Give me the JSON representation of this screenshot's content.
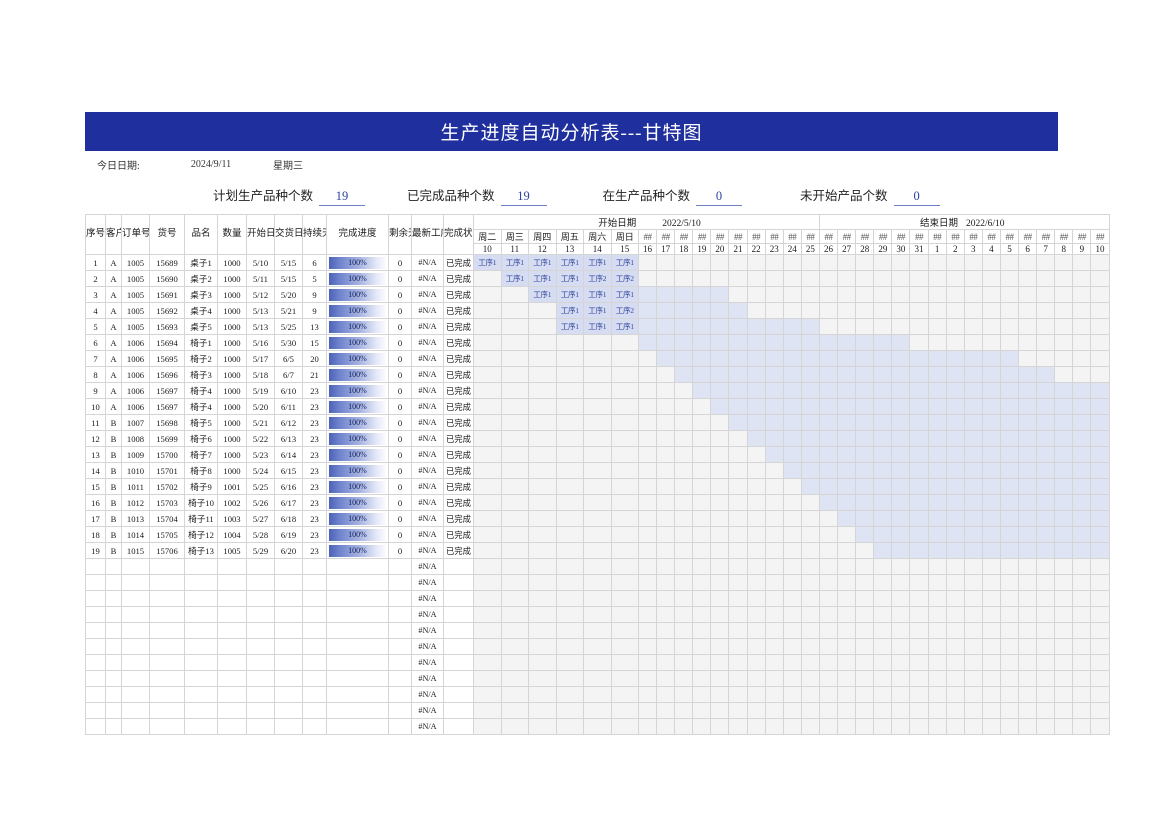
{
  "title": "生产进度自动分析表---甘特图",
  "today": {
    "label": "今日日期:",
    "date": "2024/9/11",
    "weekday": "星期三"
  },
  "summary": [
    {
      "label": "计划生产品种个数",
      "value": "19"
    },
    {
      "label": "已完成品种个数",
      "value": "19"
    },
    {
      "label": "在生产品种个数",
      "value": "0"
    },
    {
      "label": "未开始产品个数",
      "value": "0"
    }
  ],
  "columns": {
    "seq": "序号",
    "customer": "客户",
    "order": "订单号",
    "sku": "货号",
    "name": "品名",
    "qty": "数量",
    "start": "开始日期",
    "due": "交货日期",
    "duration": "持续天数",
    "progress": "完成进度",
    "remaining": "剩余天数",
    "latest_op": "最新工序状态",
    "status": "完成状态"
  },
  "gantt_header": {
    "start_label": "开始日期",
    "start_date": "2022/5/10",
    "end_label": "结束日期",
    "end_date": "2022/6/10",
    "weekdays": [
      "周二",
      "周三",
      "周四",
      "周五",
      "周六",
      "周日",
      "##",
      "##",
      "##",
      "##",
      "##",
      "##",
      "##",
      "##",
      "##",
      "##",
      "##",
      "##",
      "##",
      "##",
      "##",
      "##",
      "##",
      "##",
      "##",
      "##",
      "##",
      "##",
      "##",
      "##",
      "##",
      "##"
    ],
    "days": [
      10,
      11,
      12,
      13,
      14,
      15,
      16,
      17,
      18,
      19,
      20,
      21,
      22,
      23,
      24,
      25,
      26,
      27,
      28,
      29,
      30,
      31,
      1,
      2,
      3,
      4,
      5,
      6,
      7,
      8,
      9,
      10
    ]
  },
  "rows": [
    {
      "seq": "1",
      "customer": "A",
      "order": "1005",
      "sku": "15689",
      "name": "桌子1",
      "qty": "1000",
      "start": "5/10",
      "due": "5/15",
      "duration": "6",
      "progress": "100%",
      "progress_pct": 100,
      "remaining": "0",
      "latest_op": "#N/A",
      "status": "已完成",
      "bar_start": 0,
      "bar_len": 6,
      "ops": [
        "工序1",
        "工序1",
        "工序1",
        "工序1",
        "工序1",
        "工序1"
      ]
    },
    {
      "seq": "2",
      "customer": "A",
      "order": "1005",
      "sku": "15690",
      "name": "桌子2",
      "qty": "1000",
      "start": "5/11",
      "due": "5/15",
      "duration": "5",
      "progress": "100%",
      "progress_pct": 100,
      "remaining": "0",
      "latest_op": "#N/A",
      "status": "已完成",
      "bar_start": 1,
      "bar_len": 5,
      "ops": [
        "工序1",
        "工序1",
        "工序1",
        "工序2",
        "工序2"
      ]
    },
    {
      "seq": "3",
      "customer": "A",
      "order": "1005",
      "sku": "15691",
      "name": "桌子3",
      "qty": "1000",
      "start": "5/12",
      "due": "5/20",
      "duration": "9",
      "progress": "100%",
      "progress_pct": 100,
      "remaining": "0",
      "latest_op": "#N/A",
      "status": "已完成",
      "bar_start": 2,
      "bar_len": 9,
      "ops": [
        "工序1",
        "工序1",
        "工序1",
        "工序1"
      ]
    },
    {
      "seq": "4",
      "customer": "A",
      "order": "1005",
      "sku": "15692",
      "name": "桌子4",
      "qty": "1000",
      "start": "5/13",
      "due": "5/21",
      "duration": "9",
      "progress": "100%",
      "progress_pct": 100,
      "remaining": "0",
      "latest_op": "#N/A",
      "status": "已完成",
      "bar_start": 3,
      "bar_len": 9,
      "ops": [
        "工序1",
        "工序1",
        "工序2"
      ]
    },
    {
      "seq": "5",
      "customer": "A",
      "order": "1005",
      "sku": "15693",
      "name": "桌子5",
      "qty": "1000",
      "start": "5/13",
      "due": "5/25",
      "duration": "13",
      "progress": "100%",
      "progress_pct": 100,
      "remaining": "0",
      "latest_op": "#N/A",
      "status": "已完成",
      "bar_start": 3,
      "bar_len": 13,
      "ops": [
        "工序1",
        "工序1",
        "工序1"
      ]
    },
    {
      "seq": "6",
      "customer": "A",
      "order": "1006",
      "sku": "15694",
      "name": "椅子1",
      "qty": "1000",
      "start": "5/16",
      "due": "5/30",
      "duration": "15",
      "progress": "100%",
      "progress_pct": 100,
      "remaining": "0",
      "latest_op": "#N/A",
      "status": "已完成",
      "bar_start": 6,
      "bar_len": 15,
      "ops": []
    },
    {
      "seq": "7",
      "customer": "A",
      "order": "1006",
      "sku": "15695",
      "name": "椅子2",
      "qty": "1000",
      "start": "5/17",
      "due": "6/5",
      "duration": "20",
      "progress": "100%",
      "progress_pct": 100,
      "remaining": "0",
      "latest_op": "#N/A",
      "status": "已完成",
      "bar_start": 7,
      "bar_len": 20,
      "ops": []
    },
    {
      "seq": "8",
      "customer": "A",
      "order": "1006",
      "sku": "15696",
      "name": "椅子3",
      "qty": "1000",
      "start": "5/18",
      "due": "6/7",
      "duration": "21",
      "progress": "100%",
      "progress_pct": 100,
      "remaining": "0",
      "latest_op": "#N/A",
      "status": "已完成",
      "bar_start": 8,
      "bar_len": 21,
      "ops": []
    },
    {
      "seq": "9",
      "customer": "A",
      "order": "1006",
      "sku": "15697",
      "name": "椅子4",
      "qty": "1000",
      "start": "5/19",
      "due": "6/10",
      "duration": "23",
      "progress": "100%",
      "progress_pct": 100,
      "remaining": "0",
      "latest_op": "#N/A",
      "status": "已完成",
      "bar_start": 9,
      "bar_len": 23,
      "ops": []
    },
    {
      "seq": "10",
      "customer": "A",
      "order": "1006",
      "sku": "15697",
      "name": "椅子4",
      "qty": "1000",
      "start": "5/20",
      "due": "6/11",
      "duration": "23",
      "progress": "100%",
      "progress_pct": 100,
      "remaining": "0",
      "latest_op": "#N/A",
      "status": "已完成",
      "bar_start": 10,
      "bar_len": 22,
      "ops": []
    },
    {
      "seq": "11",
      "customer": "B",
      "order": "1007",
      "sku": "15698",
      "name": "椅子5",
      "qty": "1000",
      "start": "5/21",
      "due": "6/12",
      "duration": "23",
      "progress": "100%",
      "progress_pct": 100,
      "remaining": "0",
      "latest_op": "#N/A",
      "status": "已完成",
      "bar_start": 11,
      "bar_len": 21,
      "ops": []
    },
    {
      "seq": "12",
      "customer": "B",
      "order": "1008",
      "sku": "15699",
      "name": "椅子6",
      "qty": "1000",
      "start": "5/22",
      "due": "6/13",
      "duration": "23",
      "progress": "100%",
      "progress_pct": 100,
      "remaining": "0",
      "latest_op": "#N/A",
      "status": "已完成",
      "bar_start": 12,
      "bar_len": 20,
      "ops": []
    },
    {
      "seq": "13",
      "customer": "B",
      "order": "1009",
      "sku": "15700",
      "name": "椅子7",
      "qty": "1000",
      "start": "5/23",
      "due": "6/14",
      "duration": "23",
      "progress": "100%",
      "progress_pct": 100,
      "remaining": "0",
      "latest_op": "#N/A",
      "status": "已完成",
      "bar_start": 13,
      "bar_len": 19,
      "ops": []
    },
    {
      "seq": "14",
      "customer": "B",
      "order": "1010",
      "sku": "15701",
      "name": "椅子8",
      "qty": "1000",
      "start": "5/24",
      "due": "6/15",
      "duration": "23",
      "progress": "100%",
      "progress_pct": 100,
      "remaining": "0",
      "latest_op": "#N/A",
      "status": "已完成",
      "bar_start": 14,
      "bar_len": 18,
      "ops": []
    },
    {
      "seq": "15",
      "customer": "B",
      "order": "1011",
      "sku": "15702",
      "name": "椅子9",
      "qty": "1001",
      "start": "5/25",
      "due": "6/16",
      "duration": "23",
      "progress": "100%",
      "progress_pct": 100,
      "remaining": "0",
      "latest_op": "#N/A",
      "status": "已完成",
      "bar_start": 15,
      "bar_len": 17,
      "ops": []
    },
    {
      "seq": "16",
      "customer": "B",
      "order": "1012",
      "sku": "15703",
      "name": "椅子10",
      "qty": "1002",
      "start": "5/26",
      "due": "6/17",
      "duration": "23",
      "progress": "100%",
      "progress_pct": 100,
      "remaining": "0",
      "latest_op": "#N/A",
      "status": "已完成",
      "bar_start": 16,
      "bar_len": 16,
      "ops": []
    },
    {
      "seq": "17",
      "customer": "B",
      "order": "1013",
      "sku": "15704",
      "name": "椅子11",
      "qty": "1003",
      "start": "5/27",
      "due": "6/18",
      "duration": "23",
      "progress": "100%",
      "progress_pct": 100,
      "remaining": "0",
      "latest_op": "#N/A",
      "status": "已完成",
      "bar_start": 17,
      "bar_len": 15,
      "ops": []
    },
    {
      "seq": "18",
      "customer": "B",
      "order": "1014",
      "sku": "15705",
      "name": "椅子12",
      "qty": "1004",
      "start": "5/28",
      "due": "6/19",
      "duration": "23",
      "progress": "100%",
      "progress_pct": 100,
      "remaining": "0",
      "latest_op": "#N/A",
      "status": "已完成",
      "bar_start": 18,
      "bar_len": 14,
      "ops": []
    },
    {
      "seq": "19",
      "customer": "B",
      "order": "1015",
      "sku": "15706",
      "name": "椅子13",
      "qty": "1005",
      "start": "5/29",
      "due": "6/20",
      "duration": "23",
      "progress": "100%",
      "progress_pct": 100,
      "remaining": "0",
      "latest_op": "#N/A",
      "status": "已完成",
      "bar_start": 19,
      "bar_len": 13,
      "ops": []
    }
  ],
  "empty_rows": [
    {
      "latest_op": "#N/A"
    },
    {
      "latest_op": "#N/A"
    },
    {
      "latest_op": "#N/A"
    },
    {
      "latest_op": "#N/A"
    },
    {
      "latest_op": "#N/A"
    },
    {
      "latest_op": "#N/A"
    },
    {
      "latest_op": "#N/A"
    },
    {
      "latest_op": "#N/A"
    },
    {
      "latest_op": "#N/A"
    },
    {
      "latest_op": "#N/A"
    },
    {
      "latest_op": "#N/A"
    }
  ],
  "colors": {
    "banner": "#1f2f9e",
    "bar": "#dfe4f4",
    "bar_label_bg": "#d6ddf2",
    "op_text": "#33459c",
    "progress_fill": "#4c62b8",
    "accent_value": "#2b3fa0"
  }
}
